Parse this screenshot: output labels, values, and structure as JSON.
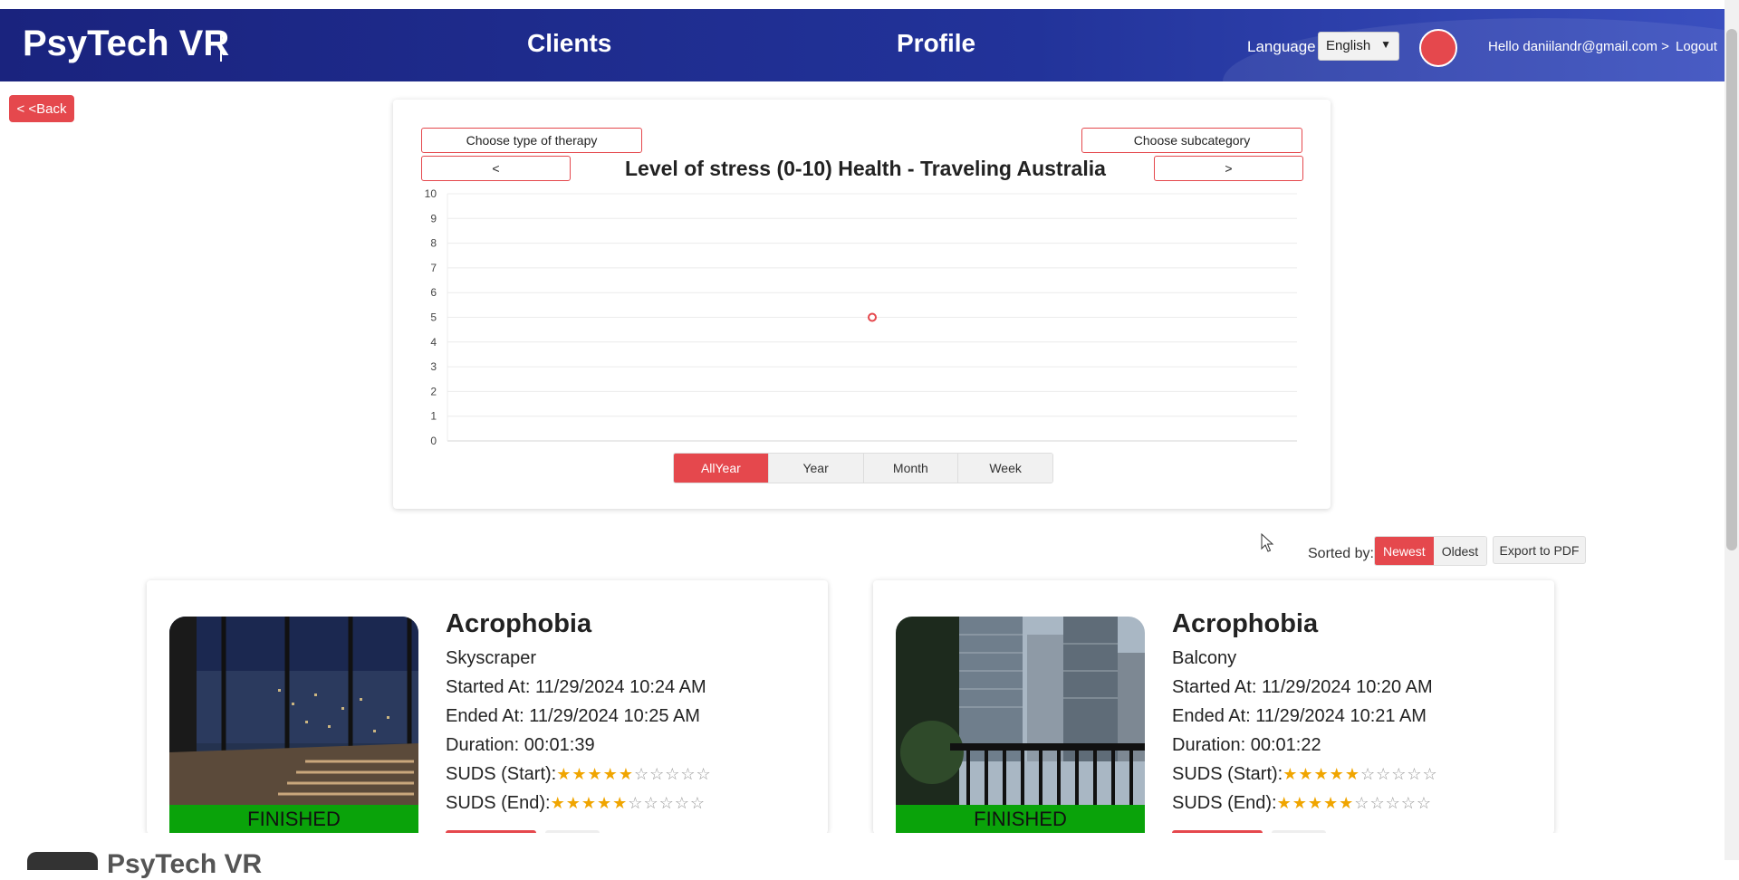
{
  "nav": {
    "brand": "PsyTech VR",
    "links": [
      "Clients",
      "Profile"
    ],
    "language_label": "Language",
    "language_value": "English",
    "hello": "Hello daniilandr@gmail.com >",
    "logout": "Logout"
  },
  "back_label": "< <Back",
  "chart_controls": {
    "therapy_type": "Choose type of therapy",
    "subcategory": "Choose subcategory",
    "prev": "<",
    "next": ">",
    "ranges": [
      "AllYear",
      "Year",
      "Month",
      "Week"
    ],
    "active_range": "AllYear"
  },
  "chart_data": {
    "type": "scatter",
    "title": "Level of stress (0-10) Health - Traveling Australia",
    "ylim": [
      0,
      10
    ],
    "yticks": [
      "0",
      "1",
      "2",
      "3",
      "4",
      "5",
      "6",
      "7",
      "8",
      "9",
      "10"
    ],
    "grid": true,
    "points": [
      {
        "x": 0.5,
        "y": 5
      }
    ],
    "point_color": "#e5484d"
  },
  "sort": {
    "label": "Sorted by:",
    "options": [
      "Newest",
      "Oldest"
    ],
    "active": "Newest",
    "export_label": "Export to PDF"
  },
  "sessions": [
    {
      "title": "Acrophobia",
      "subtitle": "Skyscraper",
      "started": "Started At: 11/29/2024 10:24 AM",
      "ended": "Ended At: 11/29/2024 10:25 AM",
      "duration": "Duration: 00:01:39",
      "suds_start_label": "SUDS (Start):",
      "suds_start": 5,
      "suds_end_label": "SUDS (End):",
      "suds_end": 5,
      "status": "FINISHED"
    },
    {
      "title": "Acrophobia",
      "subtitle": "Balcony",
      "started": "Started At: 11/29/2024 10:20 AM",
      "ended": "Ended At: 11/29/2024 10:21 AM",
      "duration": "Duration: 00:01:22",
      "suds_start_label": "SUDS (Start):",
      "suds_start": 5,
      "suds_end_label": "SUDS (End):",
      "suds_end": 5,
      "status": "FINISHED"
    }
  ],
  "footer": {
    "brand": "PsyTech VR"
  },
  "colors": {
    "accent": "#e5484d",
    "nav": "#1a237e",
    "finished": "#0aa30a",
    "star": "#f0a500"
  }
}
